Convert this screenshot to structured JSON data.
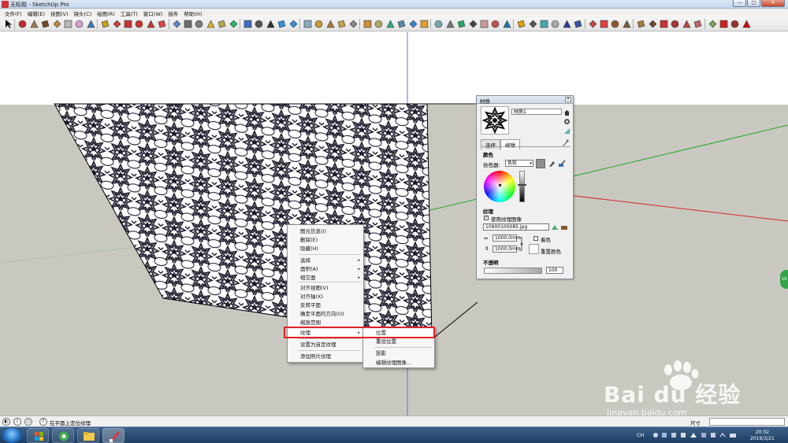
{
  "window": {
    "title": "无标题 - SketchUp Pro",
    "btn_min": "—",
    "btn_max": "□",
    "btn_close": "✕"
  },
  "menu": [
    "文件(F)",
    "编辑(E)",
    "视图(V)",
    "镜头(C)",
    "绘图(R)",
    "工具(T)",
    "窗口(W)",
    "插件",
    "帮助(H)"
  ],
  "materials": {
    "title": "材质",
    "close": "×",
    "name": "材质1",
    "tabs": [
      "选择",
      "编辑"
    ],
    "color_heading": "颜色",
    "picker_label": "拾色器:",
    "picker_value": "色轮",
    "picker_arrow": "▾",
    "texture_heading": "纹理",
    "use_texture_label": "使用纹理图像",
    "texture_file": "10900100085.jpg",
    "width": "1000.0mm",
    "height": "1000.0mm",
    "colorize_label": "着色",
    "reset_color_label": "重置颜色",
    "opacity_heading": "不透明",
    "opacity_value": "100",
    "check": "✓"
  },
  "context_menu": {
    "items": [
      {
        "label": "图元信息(I)",
        "sub": ""
      },
      {
        "label": "删除(E)",
        "sub": ""
      },
      {
        "label": "隐藏(H)",
        "sub": ""
      },
      {
        "label": "选择",
        "sub": "▸"
      },
      {
        "label": "面积(A)",
        "sub": "▸"
      },
      {
        "label": "相交面",
        "sub": "▸"
      },
      {
        "label": "对齐视图(V)",
        "sub": ""
      },
      {
        "label": "对齐轴(X)",
        "sub": ""
      },
      {
        "label": "反转平面",
        "sub": ""
      },
      {
        "label": "确定平面的方向(O)",
        "sub": ""
      },
      {
        "label": "缩放范围",
        "sub": ""
      },
      {
        "label": "纹理",
        "sub": "▸"
      },
      {
        "label": "设置为自定纹理",
        "sub": ""
      },
      {
        "label": "添加照片纹理",
        "sub": ""
      }
    ]
  },
  "texture_submenu": {
    "items": [
      "位置",
      "重设位置",
      "投影",
      "编辑纹理图像..."
    ]
  },
  "status": {
    "hint": "在平面上定位纹理",
    "measure_label": "尺寸",
    "help_glyph": "?",
    "circle_glyphs": [
      "◐",
      "i",
      "○"
    ]
  },
  "taskbar": {
    "tray_lang": "CH",
    "time": "20:32",
    "date": "2016/3/21"
  },
  "watermark": {
    "text": "Bai du 经验",
    "url": "jingyan.baidu.com"
  },
  "side_badge": "19",
  "colors": {
    "sky": "#ffffff",
    "ground": "#c8c8c0",
    "axis_red": "#d62a2a",
    "axis_green": "#2aa52a",
    "axis_blue": "#3b3be0",
    "highlight": "#e0202a"
  }
}
